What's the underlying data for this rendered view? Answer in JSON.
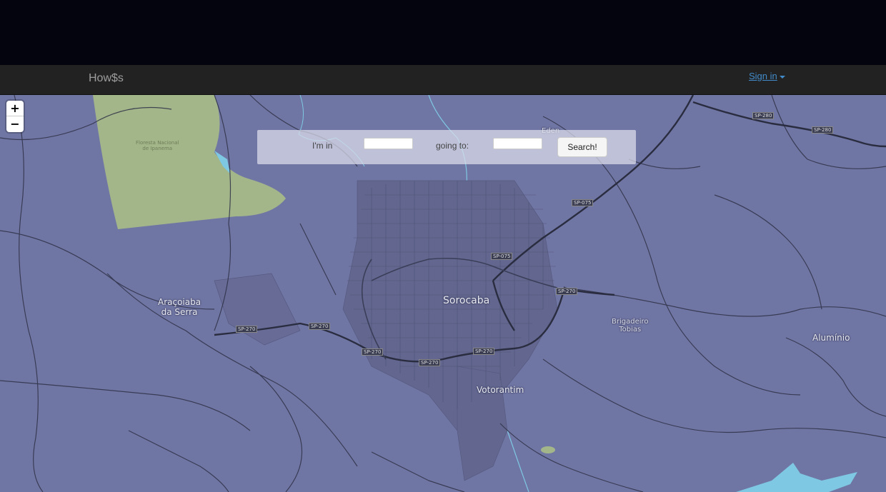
{
  "navbar": {
    "brand": "How$s",
    "signin_label": "Sign in"
  },
  "map": {
    "zoom_in": "+",
    "zoom_out": "−",
    "places": [
      {
        "name": "Sorocaba",
        "size": "big"
      },
      {
        "name": "Votorantim",
        "size": "med"
      },
      {
        "name": "Araçoiaba\nda Serra",
        "size": "med"
      },
      {
        "name": "Brigadeiro\nTobias",
        "size": "sm"
      },
      {
        "name": "Alumínio",
        "size": "med"
      },
      {
        "name": "Floresta Nacional\nde Ipanema",
        "size": "sm"
      },
      {
        "name": "Eden",
        "size": "sm"
      }
    ],
    "roads": [
      "SP-280",
      "SP-280",
      "SP-075",
      "SP-075",
      "SP-270",
      "SP-270",
      "SP-270",
      "SP-270",
      "SP-270",
      "SP-270"
    ]
  },
  "search": {
    "from_label": "I'm in",
    "from_value": "",
    "to_label": "going to:",
    "to_value": "",
    "button_label": "Search!"
  },
  "colors": {
    "map_background": "#7076a4",
    "park": "#a3b68a",
    "water": "#7ec8e3",
    "navbar": "#222222",
    "link": "#428bca"
  }
}
